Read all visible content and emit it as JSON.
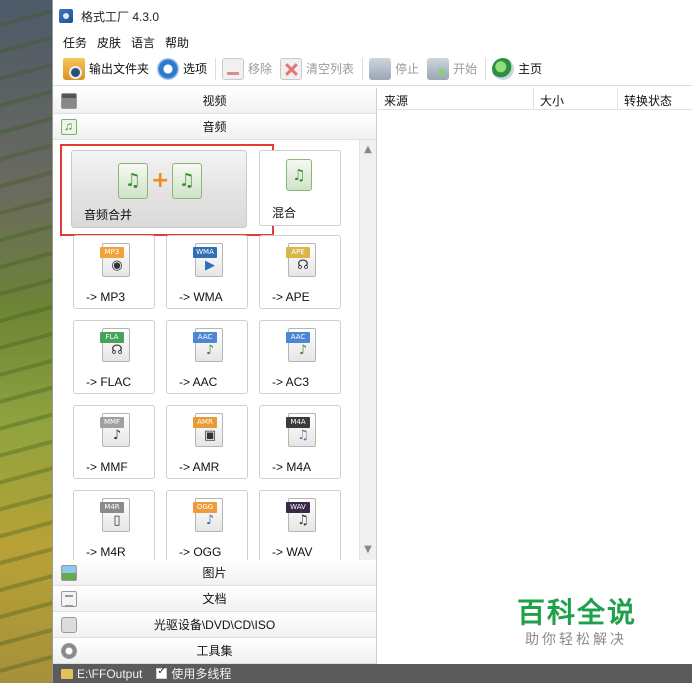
{
  "window": {
    "title": "格式工厂 4.3.0"
  },
  "menu": {
    "items": [
      "任务",
      "皮肤",
      "语言",
      "帮助"
    ]
  },
  "toolbar": {
    "output_folder": "输出文件夹",
    "options": "选项",
    "remove": "移除",
    "clear_list": "清空列表",
    "stop": "停止",
    "start": "开始",
    "home": "主页"
  },
  "categories": {
    "video": "视频",
    "audio": "音频",
    "picture": "图片",
    "document": "文档",
    "disc": "光驱设备\\DVD\\CD\\ISO",
    "tools": "工具集"
  },
  "audio_tools": {
    "merge": "音频合并",
    "mix": "混合",
    "formats": [
      {
        "label": "-> MP3",
        "tag": "MP3",
        "tag_color": "#f2a23a",
        "icon": "speaker-icon"
      },
      {
        "label": "-> WMA",
        "tag": "WMA",
        "tag_color": "#2f6fb8",
        "icon": "play-disc-icon"
      },
      {
        "label": "-> APE",
        "tag": "APE",
        "tag_color": "#d9b64a",
        "icon": "headphone-icon"
      },
      {
        "label": "-> FLAC",
        "tag": "FLA",
        "tag_color": "#46a35a",
        "icon": "headset-icon"
      },
      {
        "label": "-> AAC",
        "tag": "AAC",
        "tag_color": "#4d86d4",
        "icon": "speaker-note-icon"
      },
      {
        "label": "-> AC3",
        "tag": "AAC",
        "tag_color": "#4d86d4",
        "icon": "speaker-note-icon"
      },
      {
        "label": "-> MMF",
        "tag": "MMF",
        "tag_color": "#a0a0a0",
        "icon": "note-icon"
      },
      {
        "label": "-> AMR",
        "tag": "AMR",
        "tag_color": "#e89a36",
        "icon": "device-icon"
      },
      {
        "label": "-> M4A",
        "tag": "M4A",
        "tag_color": "#3b3b3b",
        "icon": "disc-note-icon"
      },
      {
        "label": "-> M4R",
        "tag": "M4R",
        "tag_color": "#8a8a8a",
        "icon": "phone-icon"
      },
      {
        "label": "-> OGG",
        "tag": "OGG",
        "tag_color": "#ef9a3c",
        "icon": "note-icon"
      },
      {
        "label": "-> WAV",
        "tag": "WAV",
        "tag_color": "#3a2a4a",
        "icon": "notes-icon"
      }
    ]
  },
  "file_list": {
    "columns": [
      "来源",
      "大小",
      "转换状态"
    ]
  },
  "watermark": {
    "title": "百科全说",
    "subtitle": "助你轻松解决"
  },
  "status": {
    "output_path": "E:\\FFOutput",
    "multithread_label": "使用多线程",
    "multithread_checked": true
  }
}
